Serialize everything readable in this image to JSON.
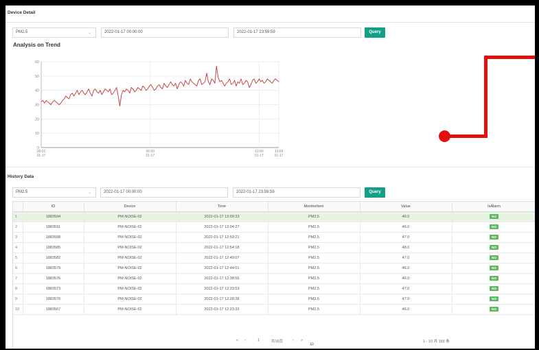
{
  "device_detail": {
    "title": "Device Detail",
    "pollutant": "PM2.5",
    "start_time": "2022-01-17 00:00:00",
    "end_time": "2022-01-17 23:59:59",
    "query_label": "Query"
  },
  "chart": {
    "title": "Analysis on Trend"
  },
  "chart_data": {
    "type": "line",
    "title": "Analysis on Trend",
    "ylim": [
      0,
      60
    ],
    "y_ticks": [
      "0",
      "10",
      "20",
      "30",
      "40",
      "50",
      "60"
    ],
    "x_ticks": [
      {
        "value": 0,
        "time": "00:01",
        "date": "01-17"
      },
      {
        "value": 1,
        "time": "06:00",
        "date": "01-17"
      },
      {
        "value": 2,
        "time": "12:00",
        "date": "01-17"
      },
      {
        "value": 2.18,
        "time": "13:09",
        "date": "01-17"
      }
    ],
    "grid": true,
    "color": "#c23531",
    "series": [
      {
        "values": [
          32,
          33,
          31,
          33,
          32,
          31,
          30,
          32,
          33,
          32,
          31,
          30,
          31,
          33,
          34,
          36,
          35,
          34,
          37,
          38,
          36,
          38,
          40,
          37,
          39,
          40,
          38,
          37,
          39,
          41,
          38,
          36,
          40,
          41,
          39,
          38,
          40,
          37,
          39,
          41,
          40,
          39,
          41,
          37,
          38,
          40,
          42,
          36,
          29,
          37,
          40,
          39,
          41,
          40,
          38,
          42,
          41,
          39,
          40,
          42,
          41,
          40,
          43,
          42,
          40,
          41,
          43,
          44,
          42,
          40,
          41,
          43,
          44,
          42,
          41,
          45,
          43,
          42,
          44,
          46,
          44,
          43,
          45,
          41,
          44,
          46,
          45,
          43,
          47,
          45,
          44,
          48,
          46,
          45,
          44,
          43,
          47,
          48,
          44,
          45,
          46,
          52,
          46,
          44,
          48,
          47,
          45,
          57,
          49,
          46,
          47,
          45,
          43,
          45,
          46,
          48,
          44,
          45,
          47,
          43,
          46,
          45,
          48,
          44,
          45,
          47,
          46,
          42,
          44,
          47,
          48,
          45,
          46,
          48,
          46,
          47,
          45,
          46,
          48,
          47,
          46,
          45,
          47,
          48,
          47,
          46
        ]
      }
    ]
  },
  "history": {
    "title": "History Data",
    "pollutant": "PM2.5",
    "start_time": "2022-01-17 00:00:00",
    "end_time": "2022-01-17 23:59:59",
    "query_label": "Query",
    "columns": [
      "ID",
      "Device",
      "Time",
      "MonitorItem",
      "Value",
      "IsAlarm"
    ],
    "rows": [
      {
        "n": "1",
        "id": "1883594",
        "device": "PM-NOISE-02",
        "time": "2022-01-17 13:09:33",
        "item": "PM2.5",
        "value": "46.0",
        "alarm": "NO"
      },
      {
        "n": "2",
        "id": "1883591",
        "device": "PM-NOISE-02",
        "time": "2022-01-17 13:04:27",
        "item": "PM2.5",
        "value": "46.0",
        "alarm": "NO"
      },
      {
        "n": "3",
        "id": "1883588",
        "device": "PM-NOISE-02",
        "time": "2022-01-17 12:59:21",
        "item": "PM2.5",
        "value": "47.0",
        "alarm": "NO"
      },
      {
        "n": "4",
        "id": "1883585",
        "device": "PM-NOISE-02",
        "time": "2022-01-17 12:54:18",
        "item": "PM2.5",
        "value": "48.0",
        "alarm": "NO"
      },
      {
        "n": "5",
        "id": "1883582",
        "device": "PM-NOISE-02",
        "time": "2022-01-17 12:49:07",
        "item": "PM2.5",
        "value": "47.0",
        "alarm": "NO"
      },
      {
        "n": "6",
        "id": "1883579",
        "device": "PM-NOISE-02",
        "time": "2022-01-17 12:44:01",
        "item": "PM2.5",
        "value": "46.0",
        "alarm": "NO"
      },
      {
        "n": "7",
        "id": "1883576",
        "device": "PM-NOISE-02",
        "time": "2022-01-17 12:38:56",
        "item": "PM2.5",
        "value": "46.0",
        "alarm": "NO"
      },
      {
        "n": "8",
        "id": "1883573",
        "device": "PM-NOISE-02",
        "time": "2022-01-17 12:33:53",
        "item": "PM2.5",
        "value": "47.0",
        "alarm": "NO"
      },
      {
        "n": "9",
        "id": "1883570",
        "device": "PM-NOISE-02",
        "time": "2022-01-17 12:28:38",
        "item": "PM2.5",
        "value": "47.0",
        "alarm": "NO"
      },
      {
        "n": "10",
        "id": "1883567",
        "device": "PM-NOISE-02",
        "time": "2022-01-17 12:23:32",
        "item": "PM2.5",
        "value": "46.0",
        "alarm": "NO"
      }
    ]
  },
  "pager": {
    "first": "«",
    "prev": "‹",
    "page": "1",
    "total_pages": "共16页",
    "next": "›",
    "last": "»",
    "page_size": "10",
    "summary": "1 - 10  共 155 条"
  },
  "colors": {
    "accent": "#139e86",
    "line": "#c23531",
    "alarm_badge": "#5cb85c",
    "selected_row": "#e8f4e3",
    "annotation": "#e41010"
  }
}
